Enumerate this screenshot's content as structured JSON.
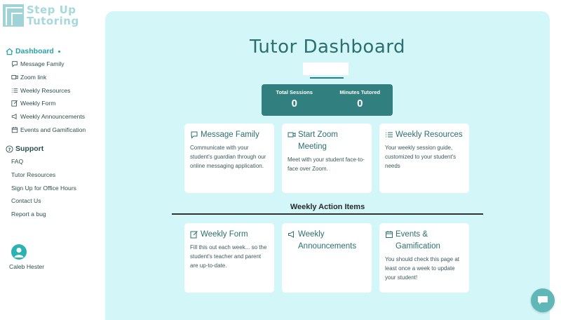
{
  "brand": {
    "line1": "Step Up",
    "line2": "Tutoring"
  },
  "sidebar": {
    "dashboard_label": "Dashboard",
    "dashboard_items": [
      {
        "label": "Message Family",
        "icon": "chat-icon"
      },
      {
        "label": "Zoom link",
        "icon": "video-icon"
      },
      {
        "label": "Weekly Resources",
        "icon": "list-icon"
      },
      {
        "label": "Weekly Form",
        "icon": "edit-icon"
      },
      {
        "label": "Weekly Announcements",
        "icon": "megaphone-icon"
      },
      {
        "label": "Events and Gamification",
        "icon": "calendar-icon"
      }
    ],
    "support_label": "Support",
    "support_items": [
      {
        "label": "FAQ"
      },
      {
        "label": "Tutor Resources"
      },
      {
        "label": "Sign Up for Office Hours"
      },
      {
        "label": "Contact Us"
      },
      {
        "label": "Report a bug"
      }
    ],
    "user_name": "Caleb Hester"
  },
  "main": {
    "title": "Tutor Dashboard",
    "stats": {
      "sessions_label": "Total Sessions",
      "sessions_value": "0",
      "minutes_label": "Minutes Tutored",
      "minutes_value": "0"
    },
    "cards_top": [
      {
        "title": "Message Family",
        "icon": "chat-icon",
        "desc": "Communicate with your student's guardian through our online messaging application."
      },
      {
        "title": "Start Zoom Meeting",
        "icon": "video-icon",
        "desc": "Meet with your student face-to-face over Zoom."
      },
      {
        "title": "Weekly Resources",
        "icon": "list-icon",
        "desc": "Your weekly session guide, customized to your student's needs"
      }
    ],
    "section_label": "Weekly Action Items",
    "cards_bottom": [
      {
        "title": "Weekly Form",
        "icon": "edit-icon",
        "desc": "Fill this out each week... so the student's teacher and parent are up-to-date."
      },
      {
        "title": "Weekly Announcements",
        "icon": "megaphone-icon",
        "desc": ""
      },
      {
        "title": "Events & Gamification",
        "icon": "calendar-icon",
        "desc": "You should check this page at least once a week to update your student!"
      }
    ]
  },
  "colors": {
    "accent": "#27a3a8",
    "panel": "#d3f6f8",
    "stats_bg": "#327f7f",
    "title": "#2b6f6f"
  }
}
